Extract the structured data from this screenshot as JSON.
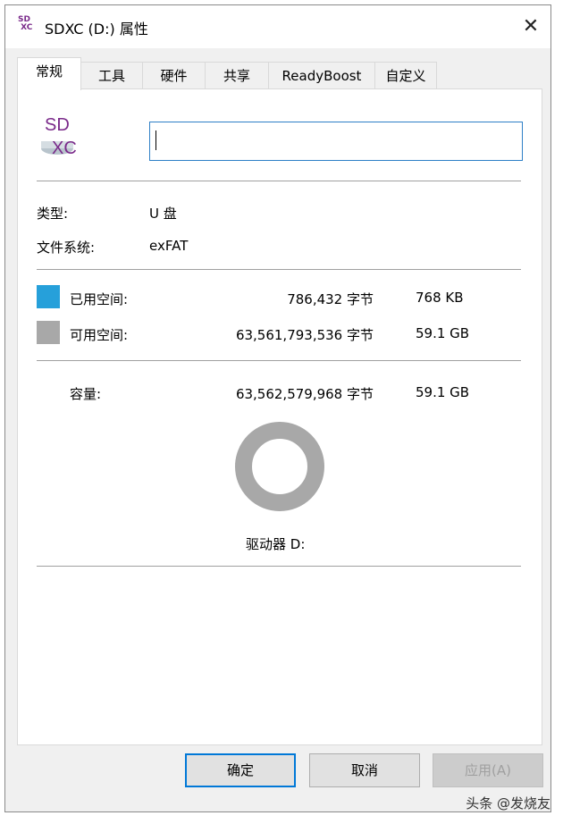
{
  "window": {
    "title": "SDXC (D:) 属性",
    "icon": "sdxc-drive-icon",
    "close": "✕"
  },
  "tabs": [
    "常规",
    "工具",
    "硬件",
    "共享",
    "ReadyBoost",
    "自定义"
  ],
  "drive_icon_text": "SD XC",
  "name_input": {
    "value": ""
  },
  "type": {
    "label": "类型:",
    "value": "U 盘"
  },
  "filesystem": {
    "label": "文件系统:",
    "value": "exFAT"
  },
  "used": {
    "label": "已用空间:",
    "bytes": "786,432 字节",
    "size": "768 KB",
    "color": "#26a0da"
  },
  "free": {
    "label": "可用空间:",
    "bytes": "63,561,793,536 字节",
    "size": "59.1 GB",
    "color": "#a8a8a8"
  },
  "capacity": {
    "label": "容量:",
    "bytes": "63,562,579,968 字节",
    "size": "59.1 GB"
  },
  "usage_fraction": 1.24e-05,
  "drive_label": "驱动器 D:",
  "buttons": {
    "ok": "确定",
    "cancel": "取消",
    "apply": "应用(A)"
  },
  "watermark": "头条 @发烧友"
}
